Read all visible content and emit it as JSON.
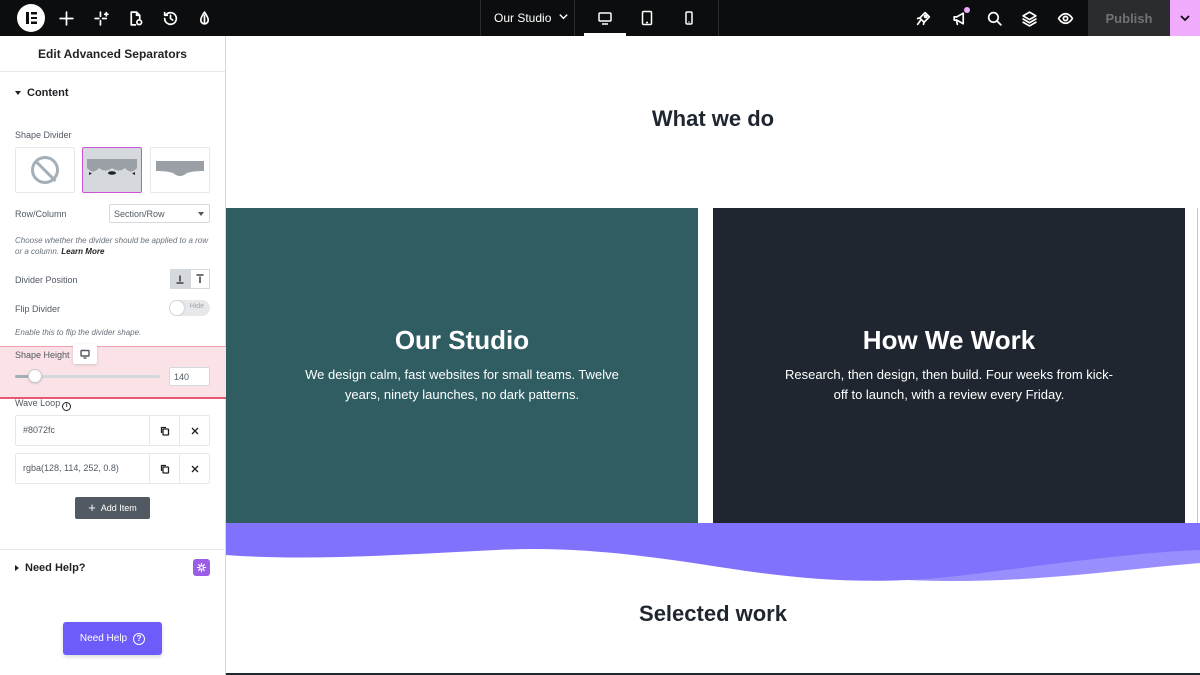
{
  "topbar": {
    "document_title": "Our Studio",
    "publish_label": "Publish"
  },
  "panel": {
    "title": "Edit Advanced Separators",
    "content_section": "Content",
    "shape_divider_label": "Shape Divider",
    "row_column_label": "Row/Column",
    "row_column_value": "Section/Row",
    "row_column_desc": "Choose whether the divider should be applied to a row or a column.",
    "learn_more": "Learn More",
    "divider_position_label": "Divider Position",
    "flip_divider_label": "Flip Divider",
    "flip_toggle_text": "Hide",
    "flip_desc": "Enable this to flip the divider shape.",
    "shape_height_label": "Shape Height",
    "shape_height_value": "140",
    "shape_height_fraction": 0.14,
    "wave_loop_label": "Wave Loop",
    "wave_items": [
      {
        "title": "#8072fc"
      },
      {
        "title": "rgba(128, 114, 252, 0.8)"
      }
    ],
    "add_item_label": "Add Item",
    "need_help_section": "Need Help?",
    "need_help_button": "Need Help"
  },
  "canvas": {
    "heading_top": "What we do",
    "cards": [
      {
        "title": "Our Studio",
        "text": "We design calm, fast websites for small teams. Twelve years, ninety launches, no dark patterns."
      },
      {
        "title": "How We Work",
        "text": "Research, then design, then build. Four weeks from kick-off to launch, with a review every Friday."
      }
    ],
    "heading_bottom": "Selected work"
  },
  "colors": {
    "accent": "#f0abfc",
    "wave_primary": "#8072fc",
    "wave_secondary": "rgba(128, 114, 252, 0.8)",
    "card_teal": "#2f5d62",
    "card_dark": "#1f2630",
    "need_help": "#6d5bfa"
  },
  "icons": {
    "topbar": [
      "elementor-logo-icon",
      "plus-icon",
      "sparkle-icon",
      "page-settings-icon",
      "history-icon",
      "contrast-icon",
      "chevron-down-icon",
      "desktop-icon",
      "tablet-icon",
      "mobile-icon",
      "rocket-icon",
      "megaphone-icon",
      "search-icon",
      "layers-icon",
      "eye-icon",
      "chevron-down-icon"
    ],
    "panel": [
      "no-divider-icon",
      "bottom-align-icon",
      "top-align-icon",
      "desktop-icon",
      "info-icon",
      "copy-icon",
      "close-icon",
      "plus-icon",
      "help-widget-icon",
      "question-icon",
      "chevron-left-icon"
    ]
  }
}
